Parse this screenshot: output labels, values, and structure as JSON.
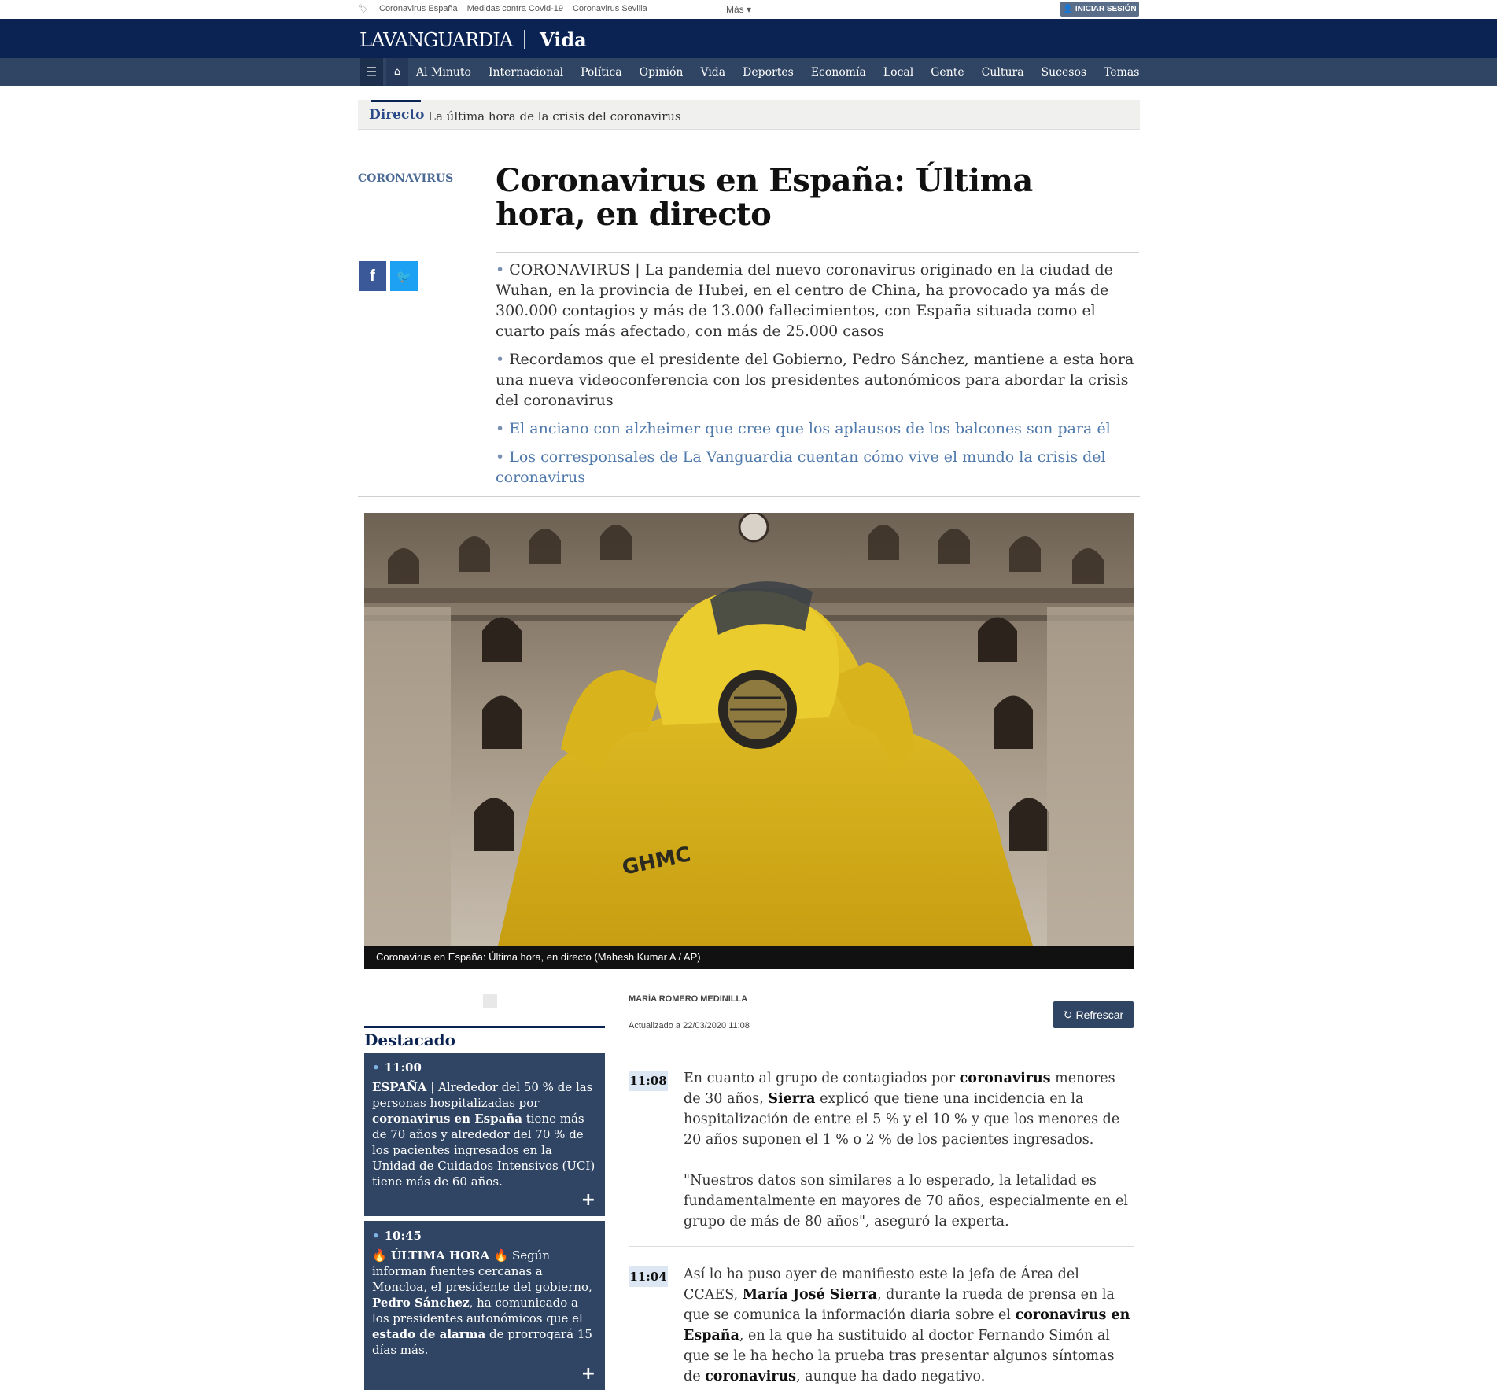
{
  "topbar": {
    "links": [
      "Coronavirus España",
      "Medidas contra Covid-19",
      "Coronavirus Sevilla"
    ],
    "more_label": "Más ▾",
    "login_label": "INICIAR SESIÓN"
  },
  "header": {
    "logo": "LAVANGUARDIA",
    "section": "Vida"
  },
  "nav": {
    "items": [
      "Al Minuto",
      "Internacional",
      "Política",
      "Opinión",
      "Vida",
      "Deportes",
      "Economía",
      "Local",
      "Gente",
      "Cultura",
      "Sucesos",
      "Temas"
    ]
  },
  "directo": {
    "label": "Directo",
    "text": "La última hora de la crisis del coronavirus"
  },
  "article": {
    "kicker": "CORONAVIRUS",
    "title": "Coronavirus en España: Última hora, en directo",
    "bullets": [
      "CORONAVIRUS | La pandemia del nuevo coronavirus originado en la ciudad de Wuhan, en la provincia de Hubei, en el centro de China, ha provocado ya más de 300.000 contagios y más de 13.000 fallecimientos, con España situada como el cuarto país más afectado, con más de 25.000 casos",
      "Recordamos que el presidente del Gobierno, Pedro Sánchez, mantiene a esta hora una nueva videoconferencia con los presidentes autonómicos para abordar la crisis del coronavirus"
    ],
    "links": [
      "El anciano con alzheimer que cree que los aplausos de los balcones son para él",
      "Los corresponsales de La Vanguardia cuentan cómo vive el mundo la crisis del coronavirus"
    ],
    "photo_text": "GHMC",
    "caption": "Coronavirus en España: Última hora, en directo (Mahesh Kumar A / AP)"
  },
  "share": {
    "facebook": "f",
    "twitter": "🐦"
  },
  "destacado": {
    "title": "Destacado",
    "cards": [
      {
        "time": "11:00",
        "lead": "ESPAÑA",
        "t1": " | Alrededor del 50 % de las personas hospitalizadas por ",
        "b1": "coronavirus en España",
        "t2": " tiene más de 70 años y alrededor del 70 % de los pacientes ingresados en la Unidad de Cuidados Intensivos (UCI) tiene más de 60 años."
      },
      {
        "time": "10:45",
        "lead": "🔥 ÚLTIMA HORA 🔥",
        "t1": " Según informan fuentes cercanas a Moncloa, el presidente del gobierno, ",
        "b1": "Pedro Sánchez",
        "t2": ", ha comunicado a los presidentes autonómicos que el ",
        "b2": "estado de alarma",
        "t3": " de prorrogará 15 días más."
      }
    ]
  },
  "feed": {
    "author": "MARÍA ROMERO MEDINILLA",
    "updated": "Actualizado a 22/03/2020 11:08",
    "refresh_label": "Refrescar",
    "entries": [
      {
        "time": "11:08",
        "p1_a": "En cuanto al grupo de contagiados por ",
        "p1_b1": "coronavirus",
        "p1_c": " menores de 30 años, ",
        "p1_b2": "Sierra",
        "p1_d": " explicó que tiene una incidencia en la hospitalización de entre el 5 % y el 10 % y que los menores de 20 años suponen el 1 % o 2 % de los pacientes ingresados.",
        "p2": "\"Nuestros datos son similares a lo esperado, la letalidad es fundamentalmente en mayores de 70 años, especialmente en el grupo de más de 80 años\", aseguró la experta."
      },
      {
        "time": "11:04",
        "p1_a": "Así lo ha puso ayer de manifiesto este la jefa de Área del CCAES, ",
        "p1_b1": "María José Sierra",
        "p1_c": ", durante la rueda de prensa en la que se comunica la información diaria sobre el ",
        "p1_b2": "coronavirus en España",
        "p1_d": ", en la que ha sustituido al doctor Fernando Simón al que se le ha hecho la prueba tras presentar algunos síntomas de ",
        "p1_b3": "coronavirus",
        "p1_e": ", aunque ha dado negativo."
      }
    ]
  },
  "colors": {
    "header_bg": "#0b2352",
    "nav_bg": "#304563",
    "accent_link": "#4f78ab",
    "facebook": "#3b5998",
    "twitter": "#1da1f2"
  }
}
